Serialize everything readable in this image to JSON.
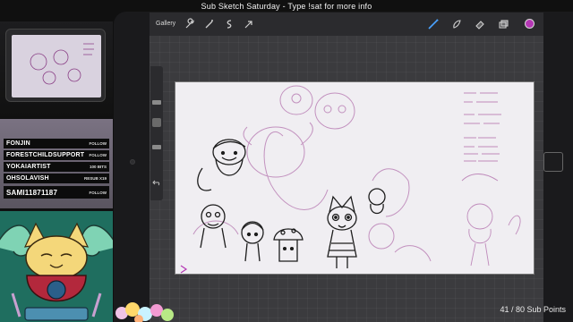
{
  "stream": {
    "title": "Sub Sketch Saturday - Type !sat for more info",
    "sub_points": "41 / 80 Sub Points"
  },
  "followers": [
    {
      "name": "FONJIN",
      "tag": "FOLLOW"
    },
    {
      "name": "FORESTCHILDSUPPORT",
      "tag": "FOLLOW"
    },
    {
      "name": "YOKAIARTIST",
      "tag": "100 BITS"
    },
    {
      "name": "OHSOLAVISH",
      "tag": "RESUB X19"
    },
    {
      "name": "SAMI11871187",
      "tag": "FOLLOW"
    }
  ],
  "procreate": {
    "gallery_label": "Gallery",
    "tools_left": [
      "wrench-icon",
      "magic-wand-icon",
      "selection-icon",
      "transform-arrow-icon"
    ],
    "tools_right": [
      "brush-icon",
      "smudge-icon",
      "eraser-icon",
      "layers-icon"
    ],
    "active_color": "#b437b4"
  },
  "colors": {
    "sketch_line": "#a24f9e",
    "ink_line": "#1d1d1d",
    "canvas": "#f0eef2",
    "ui_bar": "#2b2b2e"
  }
}
